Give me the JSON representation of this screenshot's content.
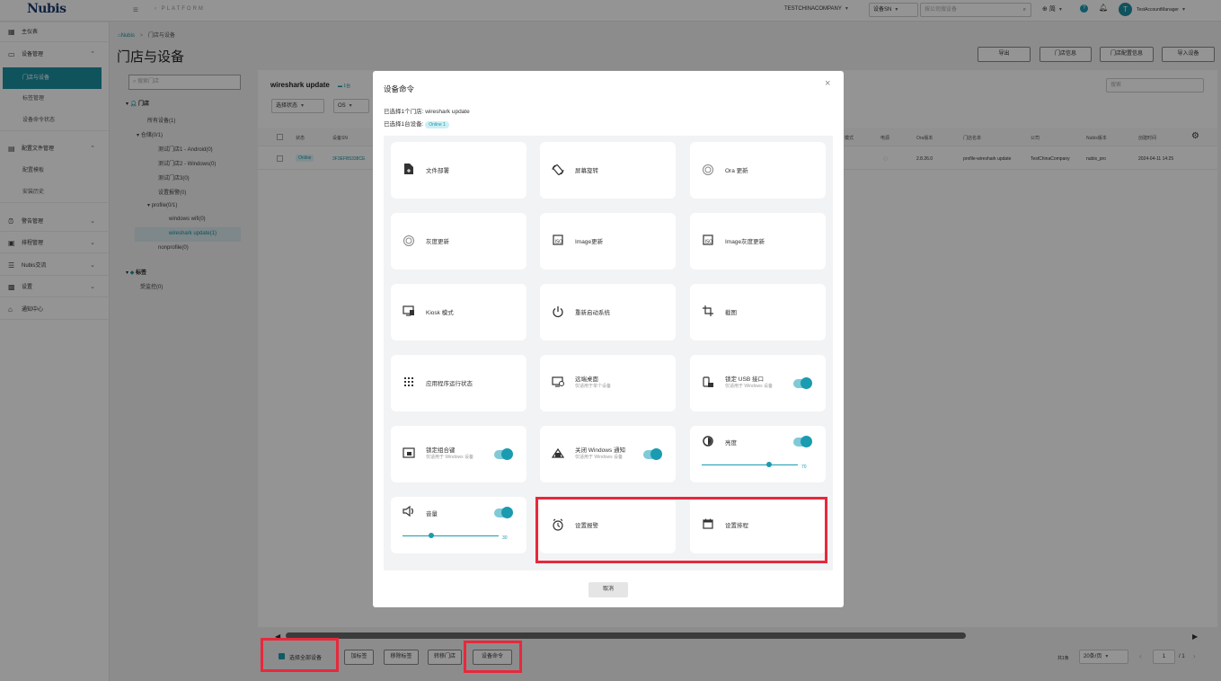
{
  "app": {
    "logo": "Nubis",
    "platform": "PLATFORM",
    "company": "TESTCHINACOMPANY",
    "search_type": "设备SN",
    "search_placeholder": "按公司搜设备",
    "language": "简",
    "user_initial": "T",
    "user_name": "TestAccountManager"
  },
  "sidebar": {
    "items": [
      {
        "label": "主仪表"
      },
      {
        "label": "设备管理"
      },
      {
        "label": "门店与设备"
      },
      {
        "label": "标签管理"
      },
      {
        "label": "设备命令状态"
      },
      {
        "label": "配置文件管理"
      },
      {
        "label": "配置模板"
      },
      {
        "label": "安装历史"
      },
      {
        "label": "警告管理"
      },
      {
        "label": "排程管理"
      },
      {
        "label": "Nubis交流"
      },
      {
        "label": "设置"
      },
      {
        "label": "通知中心"
      }
    ]
  },
  "page": {
    "breadcrumb_home": "Nubis",
    "breadcrumb_sep": ">",
    "breadcrumb_current": "门店与设备",
    "title": "门店与设备",
    "actions": [
      "导出",
      "门店信息",
      "门店配置信息",
      "导入设备"
    ]
  },
  "tree": {
    "search_placeholder": "搜索门店",
    "stores_label": "门店",
    "all_devices": "所有设备(1)",
    "warehouse": "仓储(0/1)",
    "store1": "测试门店1 - Android(0)",
    "store2": "测试门店2 - Windows(0)",
    "store3": "测试门店3(0)",
    "set_alert": "设置报警(0)",
    "profile": "profile(0/1)",
    "windows_wifi": "windows wifi(0)",
    "wireshark": "wireshark update(1)",
    "nonprofile": "nonprofile(0)",
    "tags_label": "标签",
    "tag1": "受监控(0)"
  },
  "table": {
    "store_name": "wireshark update",
    "count": "1台",
    "filter_status": "选择状态",
    "filter_os": "OS",
    "search_placeholder": "搜索",
    "headers": [
      "状态",
      "设备SN",
      "模式",
      "电源",
      "Ora版本",
      "门店名单",
      "公司",
      "Nubis版本",
      "创建时间"
    ],
    "row": {
      "status": "Online",
      "sn": "3F3EFB5338CE",
      "ora": "2.8.26.0",
      "store": "profile-wireshark update",
      "company": "TestChinaCompany",
      "nubis": "nubis_pro",
      "created": "2024-04-11 14:25"
    }
  },
  "footer": {
    "select_all": "选择全部设备",
    "add_tag": "加标签",
    "remove_tag": "移除标签",
    "transfer": "转移门店",
    "command": "设备命令",
    "total": "共1条",
    "page_size": "20条/页",
    "page": "1",
    "page_total": "/ 1"
  },
  "modal": {
    "title": "设备命令",
    "selected_store": "已选择1个门店: wireshark update",
    "selected_devices": "已选择1台设备:",
    "online_badge": "Online 1",
    "cancel": "取消",
    "cards": [
      {
        "label": "文件部署",
        "icon": "file-deploy-icon"
      },
      {
        "label": "屏幕旋转",
        "icon": "screen-rotate-icon"
      },
      {
        "label": "Ora 更新",
        "icon": "ora-update-icon"
      },
      {
        "label": "灰度更新",
        "icon": "gray-update-icon"
      },
      {
        "label": "Image更新",
        "icon": "image-update-icon"
      },
      {
        "label": "Image灰度更新",
        "icon": "image-gray-update-icon"
      },
      {
        "label": "Kiosk 模式",
        "icon": "kiosk-icon"
      },
      {
        "label": "重新启动系统",
        "icon": "power-icon"
      },
      {
        "label": "截图",
        "icon": "crop-icon"
      },
      {
        "label": "应用程序运行状态",
        "icon": "apps-grid-icon"
      },
      {
        "label": "远端桌面",
        "sub": "仅适用于单个设备",
        "icon": "remote-desktop-icon"
      },
      {
        "label": "锁定 USB 接口",
        "sub": "仅适用于 Windows 设备",
        "icon": "usb-lock-icon"
      },
      {
        "label": "锁定组合键",
        "sub": "仅适用于 Windows 设备",
        "icon": "key-lock-icon"
      },
      {
        "label": "关闭 Windows 通知",
        "sub": "仅适用于 Windows 设备",
        "icon": "notification-off-icon"
      },
      {
        "label": "亮度",
        "value": "70",
        "icon": "brightness-icon"
      },
      {
        "label": "音量",
        "value": "30",
        "icon": "volume-icon"
      },
      {
        "label": "设置报警",
        "icon": "alarm-icon"
      },
      {
        "label": "设置排程",
        "icon": "calendar-icon"
      }
    ]
  },
  "colors": {
    "accent": "#1a9bb0",
    "highlight": "#e8283c",
    "sidebar_active": "#1a8fa0"
  }
}
